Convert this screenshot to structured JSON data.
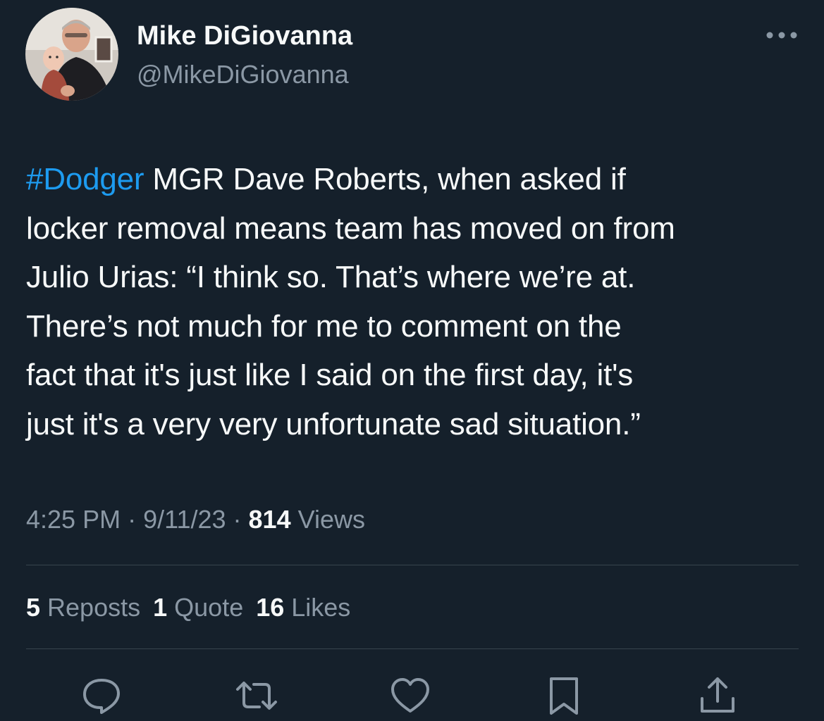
{
  "author": {
    "name": "Mike DiGiovanna",
    "handle": "@MikeDiGiovanna",
    "avatar_icon": "profile-photo"
  },
  "tweet": {
    "hashtag": "#Dodger",
    "lines": [
      " MGR Dave Roberts, when asked if",
      "locker removal means team has moved on from",
      "Julio Urias: “I think so. That’s where we’re at.",
      "There’s not much for me to comment on the",
      "fact that it's just like I said on the first day, it's",
      "just it's a very very unfortunate sad situation.”"
    ]
  },
  "meta": {
    "time": "4:25 PM",
    "separator": " · ",
    "date": "9/11/23",
    "views_count": "814",
    "views_label": " Views"
  },
  "stats": {
    "reposts_count": "5",
    "reposts_label": " Reposts",
    "quotes_count": "1",
    "quotes_label": " Quote",
    "likes_count": "16",
    "likes_label": " Likes"
  },
  "actions": [
    "reply-icon",
    "repost-icon",
    "like-icon",
    "bookmark-icon",
    "share-icon"
  ],
  "colors": {
    "background": "#15202b",
    "text_primary": "#f7f9f9",
    "text_secondary": "#8b98a5",
    "link": "#1d9bf0",
    "divider": "#38444d"
  }
}
